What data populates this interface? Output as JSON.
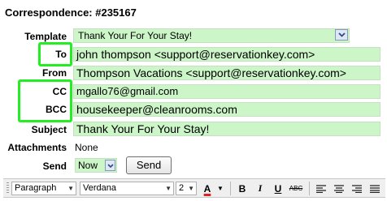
{
  "page": {
    "title": "Correspondence: #235167"
  },
  "form": {
    "template": {
      "label": "Template",
      "value": "Thank Your For Your Stay!"
    },
    "to": {
      "label": "To",
      "value": "john thompson <support@reservationkey.com>"
    },
    "from": {
      "label": "From",
      "value": "Thompson Vacations <support@reservationkey.com>"
    },
    "cc": {
      "label": "CC",
      "value": "mgallo76@gmail.com"
    },
    "bcc": {
      "label": "BCC",
      "value": "housekeeper@cleanrooms.com"
    },
    "subject": {
      "label": "Subject",
      "value": "Thank Your For Your Stay!"
    },
    "attachments": {
      "label": "Attachments",
      "value": "None"
    },
    "send": {
      "label": "Send",
      "value": "Now",
      "button": "Send"
    }
  },
  "toolbar": {
    "format": "Paragraph",
    "font": "Verdana",
    "size": "2",
    "text_color_letter": "A",
    "bold": "B",
    "italic": "I",
    "underline": "U",
    "strike": "ABC"
  },
  "colors": {
    "field_bg": "#ccf5c8",
    "highlight": "#22ee22",
    "font_color_bar": "#e02020"
  }
}
